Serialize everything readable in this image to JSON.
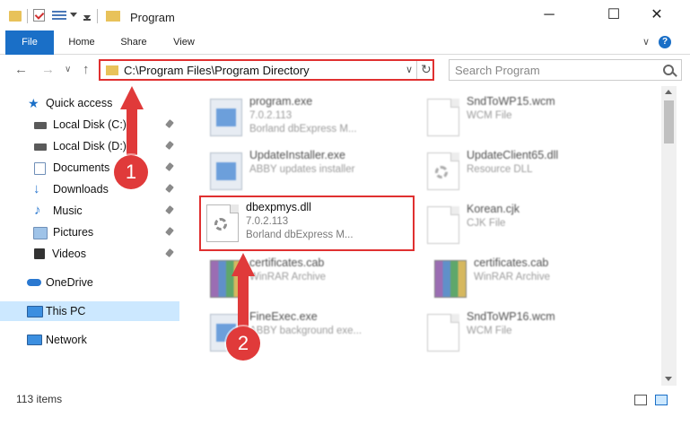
{
  "window": {
    "title": "Program",
    "minimize": "─",
    "maximize": "☐",
    "close": "✕"
  },
  "ribbon": {
    "tabs": [
      "File",
      "Home",
      "Share",
      "View"
    ],
    "collapse": "∨",
    "help": "?"
  },
  "nav": {
    "back": "←",
    "forward": "→",
    "dropdown": "∨",
    "up": "↑",
    "address": "C:\\Program Files\\Program Directory",
    "address_dropdown": "∨",
    "refresh": "↻",
    "search_placeholder": "Search Program"
  },
  "sidebar": {
    "quick_access": "Quick access",
    "items": [
      {
        "label": "Local Disk (C:)",
        "icon": "drive-icon",
        "color": "#5a5a5a"
      },
      {
        "label": "Local Disk (D:)",
        "icon": "drive-icon",
        "color": "#5a5a5a"
      },
      {
        "label": "Documents",
        "icon": "documents-icon",
        "color": "#6f8fb8"
      },
      {
        "label": "Downloads",
        "icon": "downloads-icon",
        "color": "#2a78d0"
      },
      {
        "label": "Music",
        "icon": "music-icon",
        "color": "#2a78d0"
      },
      {
        "label": "Pictures",
        "icon": "pictures-icon",
        "color": "#6f8fb8"
      },
      {
        "label": "Videos",
        "icon": "videos-icon",
        "color": "#333333"
      }
    ],
    "onedrive": "OneDrive",
    "this_pc": "This PC",
    "network": "Network"
  },
  "files": [
    {
      "name": "program.exe",
      "line2": "7.0.2.113",
      "line3": "Borland dbExpress M...",
      "icon": "exe-icon"
    },
    {
      "name": "SndToWP15.wcm",
      "line2": "WCM File",
      "line3": "",
      "icon": "document-icon"
    },
    {
      "name": "UpdateInstaller.exe",
      "line2": "ABBY updates installer",
      "line3": "",
      "icon": "app-icon"
    },
    {
      "name": "UpdateClient65.dll",
      "line2": "Resource DLL",
      "line3": "",
      "icon": "dll-icon"
    },
    {
      "name": "dbexpmys.dll",
      "line2": "7.0.2.113",
      "line3": "Borland dbExpress M...",
      "icon": "dll-gear-icon"
    },
    {
      "name": "Korean.cjk",
      "line2": "CJK File",
      "line3": "",
      "icon": "document-icon"
    },
    {
      "name": "certificates.cab",
      "line2": "WinRAR Archive",
      "line3": "",
      "icon": "winrar-icon"
    },
    {
      "name": "certificates.cab",
      "line2": "WinRAR Archive",
      "line3": "",
      "icon": "winrar-icon"
    },
    {
      "name": "FineExec.exe",
      "line2": "ABBY background exe...",
      "line3": "",
      "icon": "app-icon"
    },
    {
      "name": "SndToWP16.wcm",
      "line2": "WCM File",
      "line3": "",
      "icon": "document-icon"
    }
  ],
  "status": {
    "item_count": "113 items"
  },
  "annotations": {
    "step1": "1",
    "step2": "2",
    "accent": "#e03a3a"
  }
}
